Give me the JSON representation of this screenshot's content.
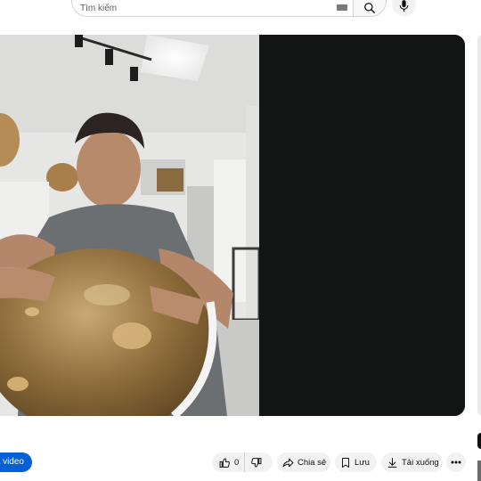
{
  "search": {
    "placeholder": "Tìm kiếm",
    "value": ""
  },
  "icons": {
    "keyboard": "keyboard-icon",
    "search": "search-icon",
    "mic": "microphone-icon",
    "like": "thumbs-up-icon",
    "dislike": "thumbs-down-icon",
    "share": "share-arrow-icon",
    "save": "bookmark-icon",
    "download": "download-icon",
    "more": "more-horizontal-icon"
  },
  "player": {
    "letterbox_color": "#131414"
  },
  "actions": {
    "subscribe_label": "a video",
    "like_count": "0",
    "share_label": "Chia sẻ",
    "save_label": "Lưu",
    "download_label": "Tải xuống"
  },
  "colors": {
    "accent": "#065fd4",
    "pill_bg": "#f2f2f2"
  }
}
